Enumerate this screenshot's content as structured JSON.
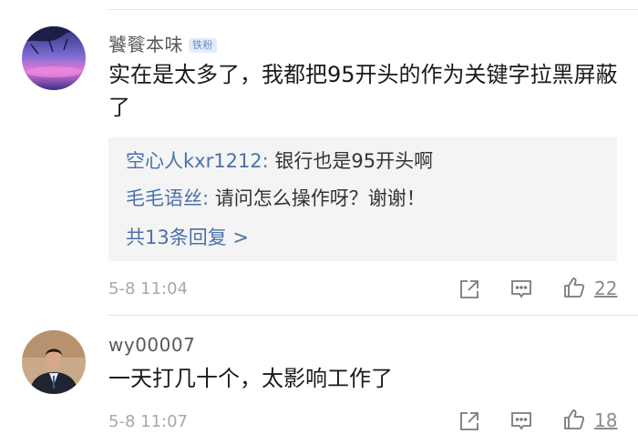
{
  "comments": [
    {
      "username": "饕餮本味",
      "badge": "铁粉",
      "content": "实在是太多了，我都把95开头的作为关键字拉黑屏蔽了",
      "replies": [
        {
          "user": "空心人kxr1212:",
          "text": " 银行也是95开头啊"
        },
        {
          "user": "毛毛语丝:",
          "text": " 请问怎么操作呀？谢谢！"
        }
      ],
      "more_replies": "共13条回复 >",
      "time": "5-8 11:04",
      "likes": "22"
    },
    {
      "username": "wy00007",
      "content": "一天打几十个，太影响工作了",
      "time": "5-8 11:07",
      "likes": "18"
    }
  ],
  "icons": [
    "share-icon",
    "comment-icon",
    "like-icon"
  ]
}
